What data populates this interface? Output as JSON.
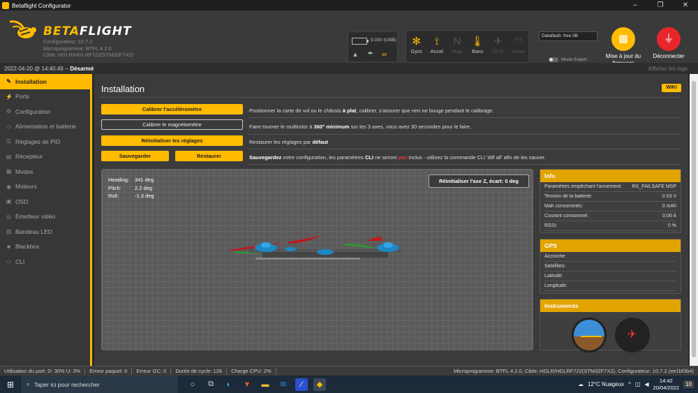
{
  "window": {
    "title": "Betaflight Configurator",
    "min": "–",
    "max": "❐",
    "close": "✕"
  },
  "header": {
    "brand_a": "BETA",
    "brand_b": "FLIGHT",
    "configurator": "Configurateur: 10.7.2",
    "firmware": "Microprogramme: BTFL 4.2.0",
    "target": "Cible: HGLR/HGLRF722(STM32F7X2)",
    "battery_voltage": "0.03V (USB)",
    "sensors": [
      {
        "label": "Gyro",
        "icon": "gyro-icon",
        "glyph": "✻",
        "active": true
      },
      {
        "label": "Accel",
        "icon": "accel-icon",
        "glyph": "⟟",
        "active": true
      },
      {
        "label": "Mag",
        "icon": "mag-icon",
        "glyph": "N",
        "active": false
      },
      {
        "label": "Baro",
        "icon": "baro-icon",
        "glyph": "🌡",
        "active": true
      },
      {
        "label": "GPS",
        "icon": "gps-icon",
        "glyph": "✈",
        "active": false
      },
      {
        "label": "Sonar",
        "icon": "sonar-icon",
        "glyph": "◠",
        "active": false
      }
    ],
    "dataflash": "Dataflash: free 0B",
    "expert_mode": "Mode Expert",
    "update_firmware": "Mise à jour du firmware",
    "disconnect": "Déconnecter"
  },
  "statusline": {
    "date": "2022-04-20 @ 14:40:49 -- ",
    "armed": "Désarmé",
    "show_logs": "Afficher les logs"
  },
  "nav": [
    {
      "label": "Installation",
      "icon": "wrench-icon",
      "glyph": "✎",
      "active": true
    },
    {
      "label": "Ports",
      "icon": "ports-icon",
      "glyph": "⚡"
    },
    {
      "label": "Configuration",
      "icon": "gear-icon",
      "glyph": "⚙"
    },
    {
      "label": "Alimentation et batterie",
      "icon": "battery-icon",
      "glyph": "▭"
    },
    {
      "label": "Réglages de PID",
      "icon": "pid-icon",
      "glyph": "☰"
    },
    {
      "label": "Récepteur",
      "icon": "receiver-icon",
      "glyph": "▤"
    },
    {
      "label": "Modes",
      "icon": "modes-icon",
      "glyph": "▦"
    },
    {
      "label": "Moteurs",
      "icon": "motor-icon",
      "glyph": "◉"
    },
    {
      "label": "OSD",
      "icon": "osd-icon",
      "glyph": "▣"
    },
    {
      "label": "Émetteur vidéo",
      "icon": "vtx-icon",
      "glyph": "◎"
    },
    {
      "label": "Bandeau LED",
      "icon": "led-icon",
      "glyph": "▥"
    },
    {
      "label": "Blackbox",
      "icon": "blackbox-icon",
      "glyph": "■"
    },
    {
      "label": "CLI",
      "icon": "cli-icon",
      "glyph": "▭"
    }
  ],
  "page": {
    "title": "Installation",
    "wiki": "WIKI",
    "calibrate_acc": "Calibrer l'accéléromètre",
    "calibrate_acc_desc_a": "Positionner la carte de vol ou le châssis ",
    "calibrate_acc_desc_b": "à plat",
    "calibrate_acc_desc_c": ", calibrer, s'assurer que rien ne bouge pendant le calibrage.",
    "calibrate_mag": "Calibrer le magnétomètre",
    "calibrate_mag_desc_a": "Faire tourner le multirotor à ",
    "calibrate_mag_desc_b": "360° minimum",
    "calibrate_mag_desc_c": " sur les 3 axes, vous avez 30 secondes pour le faire.",
    "reset": "Réinitialiser les réglages",
    "reset_desc_a": "Restaurer les réglages par ",
    "reset_desc_b": "défaut",
    "backup": "Sauvegarder",
    "restore": "Restaurer",
    "backup_desc_a": "Sauvegardez",
    "backup_desc_b": " votre configuration, les paramètres ",
    "backup_desc_c": "CLI",
    "backup_desc_d": " ne seront ",
    "backup_desc_e": "pas",
    "backup_desc_f": " inclus - utilisez la commande CLI 'diff all' afin de les sauver.",
    "reset_z": "Réinitialiser l'axe Z, écart: 0 deg",
    "heading_label": "Heading:",
    "heading": "341 deg",
    "pitch_label": "Pitch:",
    "pitch": "2.2 deg",
    "roll_label": "Roll:",
    "roll": "-1.3 deg"
  },
  "info": {
    "title": "Info",
    "rows": [
      {
        "k": "Paramètres empêchant l'armement:",
        "v": "RX_FAILSAFE  MSP"
      },
      {
        "k": "Tension de la batterie:",
        "v": "0.03 V"
      },
      {
        "k": "Mah consommés:",
        "v": "0 mAh"
      },
      {
        "k": "Courant consommé:",
        "v": "0.00 A"
      },
      {
        "k": "RSSI:",
        "v": "0 %"
      }
    ]
  },
  "gps": {
    "title": "GPS",
    "rows": [
      {
        "k": "Accroche:",
        "v": ""
      },
      {
        "k": "Satellites:",
        "v": ""
      },
      {
        "k": "Latitude:",
        "v": ""
      },
      {
        "k": "Longitude:",
        "v": ""
      }
    ]
  },
  "instruments": {
    "title": "Instruments"
  },
  "footer": {
    "port": "Utilisation du port: D: 30% U: 3%",
    "packet_err": "Erreur paquet: 0",
    "i2c_err": "Erreur I2C: 0",
    "cycle": "Durée de cycle: 126",
    "cpu": "Charge CPU: 2%",
    "right": "Microprogramme: BTFL 4.2.0, Cible: HGLR/HGLRF722(STM32F7X2), Configurateur: 10.7.2 (ee1bf3b4)"
  },
  "taskbar": {
    "search": "Taper ici pour rechercher",
    "weather": "12°C  Nuageux",
    "time": "14:42",
    "date": "20/04/2022",
    "notif": "10"
  },
  "colors": {
    "accent": "#ffbb00",
    "disconnect": "#e8252b"
  }
}
